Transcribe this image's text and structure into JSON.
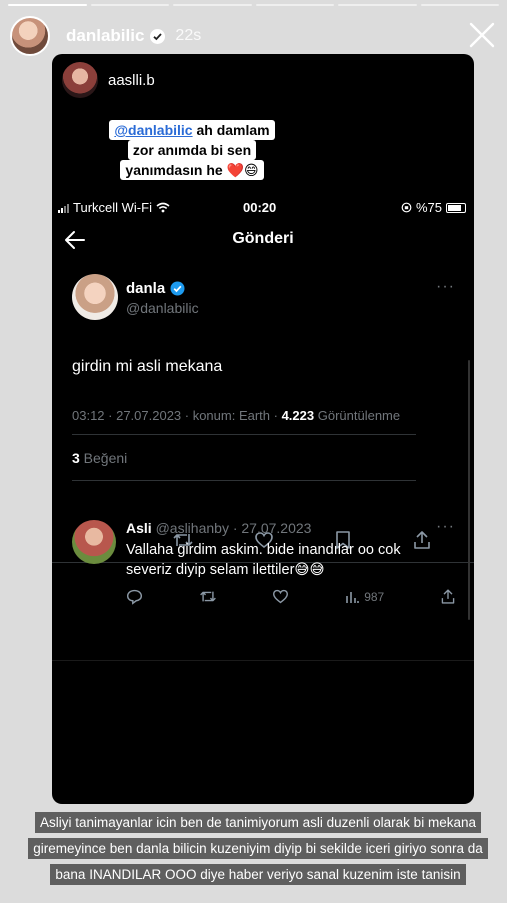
{
  "story": {
    "username": "danlabilic",
    "time": "22s",
    "progress_segments": 6,
    "active_segment": 0,
    "caption": "Asliyi tanimayanlar icin ben de tanimiyorum asli duzenli olarak bi mekana giremeyince ben danla bilicin kuzeniyim diyip bi sekilde iceri giriyo sonra da bana INANDILAR OOO diye haber veriyo sanal kuzenim iste tanisin"
  },
  "shared_post": {
    "username": "aaslli.b",
    "sticker": {
      "mention": "@danlabilic",
      "line1_rest": " ah damlam",
      "line2": "zor anımda bi sen",
      "line3_text": "yanımdasın he ",
      "line3_emoji": "❤️😄"
    }
  },
  "status_bar": {
    "carrier": "Turkcell Wi-Fi",
    "time": "00:20",
    "battery": "%75"
  },
  "twitter": {
    "nav_title": "Gönderi",
    "tweet": {
      "name": "danla",
      "handle": "@danlabilic",
      "text": "girdin mi asli mekana",
      "meta_prefix": "03:12 · 27.07.2023 · konum: Earth · ",
      "views": "4.223",
      "views_label": " Görüntülenme",
      "likes_count": "3",
      "likes_label": " Beğeni"
    },
    "reply": {
      "name": "Asli",
      "handle_date": " @aslihanby · 27.07.2023",
      "text": "Vallaha girdim askim. bide inandılar oo cok severiz diyip selam ilettiler😅😅",
      "views": "987"
    }
  },
  "colors": {
    "card_background": "#000000",
    "muted_text": "#71767b",
    "verified_blue": "#1d9bf0",
    "mention_blue": "#2a6bd6"
  }
}
